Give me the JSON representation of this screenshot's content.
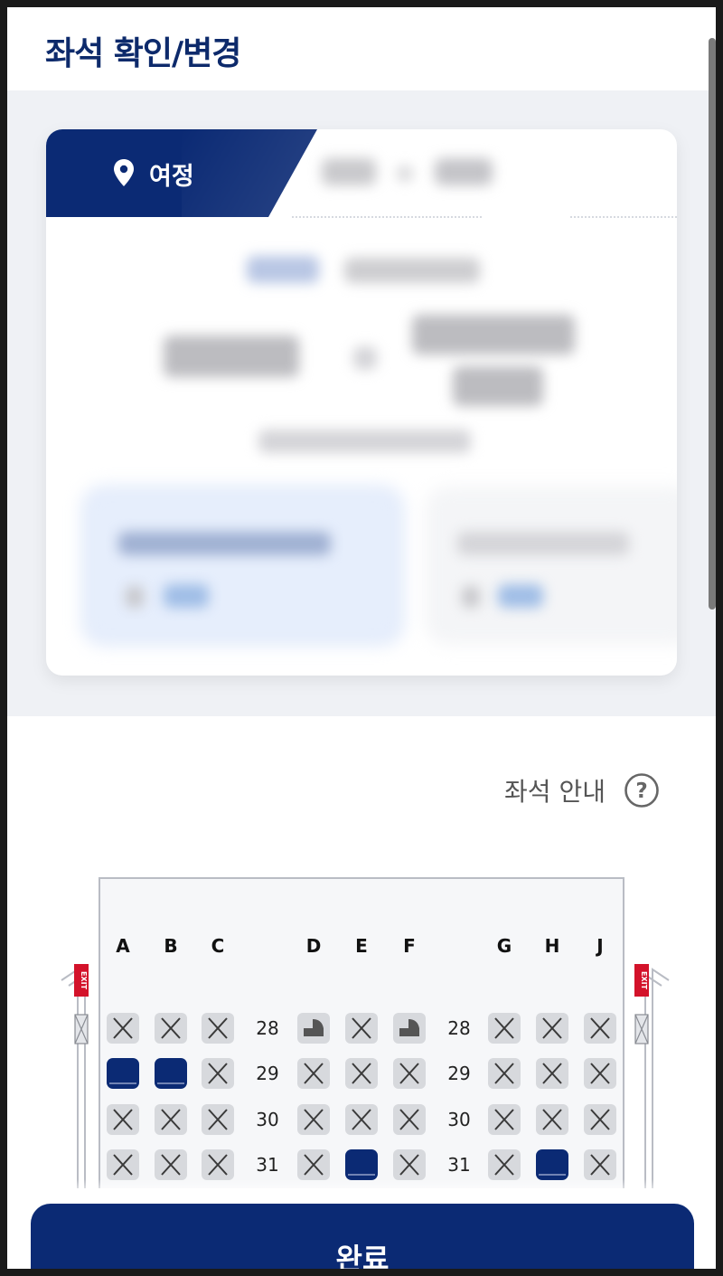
{
  "header": {
    "title": "좌석 확인/변경"
  },
  "itinerary": {
    "tab_label": "여정"
  },
  "seat_map": {
    "guide_label": "좌석 안내",
    "columns_left": [
      "A",
      "B",
      "C"
    ],
    "columns_mid": [
      "D",
      "E",
      "F"
    ],
    "columns_right": [
      "G",
      "H",
      "J"
    ],
    "rows": [
      {
        "number": "28",
        "seats": [
          "x",
          "x",
          "x",
          "bassinet",
          "x",
          "bassinet",
          "x",
          "x",
          "x"
        ]
      },
      {
        "number": "29",
        "seats": [
          "selected",
          "selected",
          "x",
          "x",
          "x",
          "x",
          "x",
          "x",
          "x"
        ]
      },
      {
        "number": "30",
        "seats": [
          "x",
          "x",
          "x",
          "x",
          "x",
          "x",
          "x",
          "x",
          "x"
        ]
      },
      {
        "number": "31",
        "seats": [
          "x",
          "x",
          "x",
          "x",
          "selected",
          "x",
          "x",
          "selected",
          "x"
        ]
      }
    ],
    "exit_label": "EXIT"
  },
  "footer": {
    "complete_label": "완료"
  },
  "colors": {
    "brand": "#0b2a74",
    "unavailable": "#d7d9dd"
  }
}
